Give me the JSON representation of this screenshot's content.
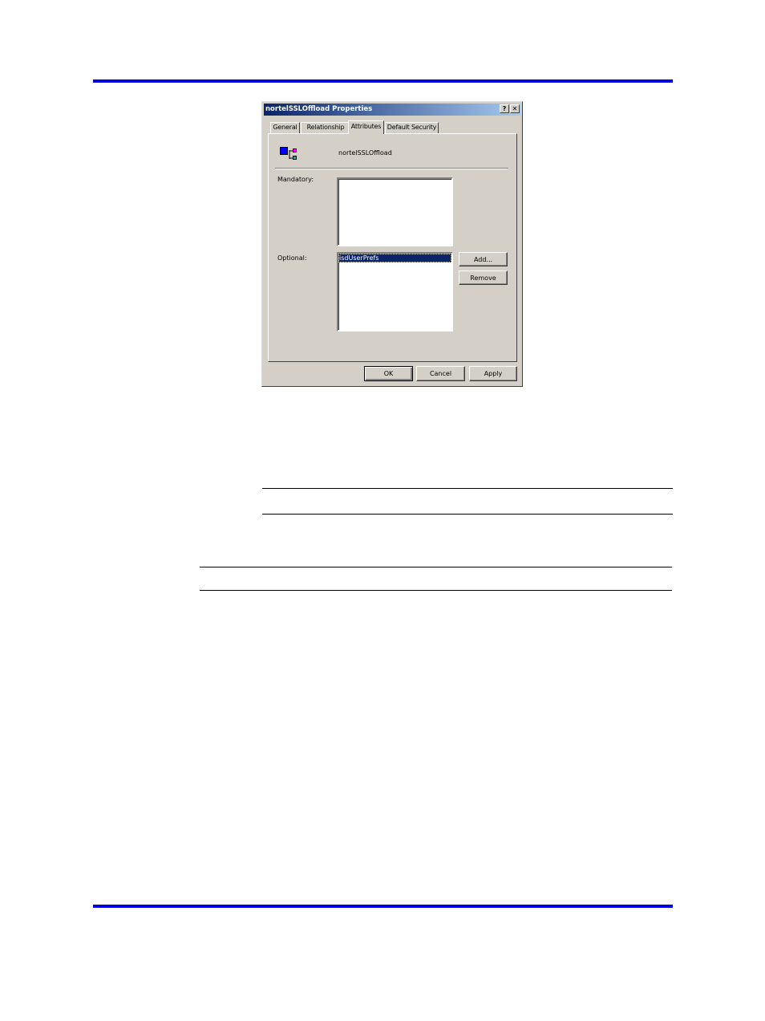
{
  "dialog": {
    "title": "nortelSSLOffload Properties",
    "help_button": "?",
    "close_button": "✕",
    "tabs": [
      {
        "label": "General"
      },
      {
        "label": "Relationship"
      },
      {
        "label": "Attributes"
      },
      {
        "label": "Default Security"
      }
    ],
    "active_tab": "Attributes",
    "object_name": "nortelSSLOffload",
    "object_icon": "class-object-icon",
    "mandatory_label": "Mandatory:",
    "mandatory_items": [],
    "optional_label": "Optional:",
    "optional_items": [
      {
        "label": "isdUserPrefs",
        "selected": true
      }
    ],
    "add_button": "Add...",
    "remove_button": "Remove",
    "ok_button": "OK",
    "cancel_button": "Cancel",
    "apply_button": "Apply"
  },
  "colors": {
    "page_rule": "#0000e0",
    "dialog_face": "#d4d0c8",
    "title_bar": "#0a246a",
    "selection": "#0a246a"
  }
}
